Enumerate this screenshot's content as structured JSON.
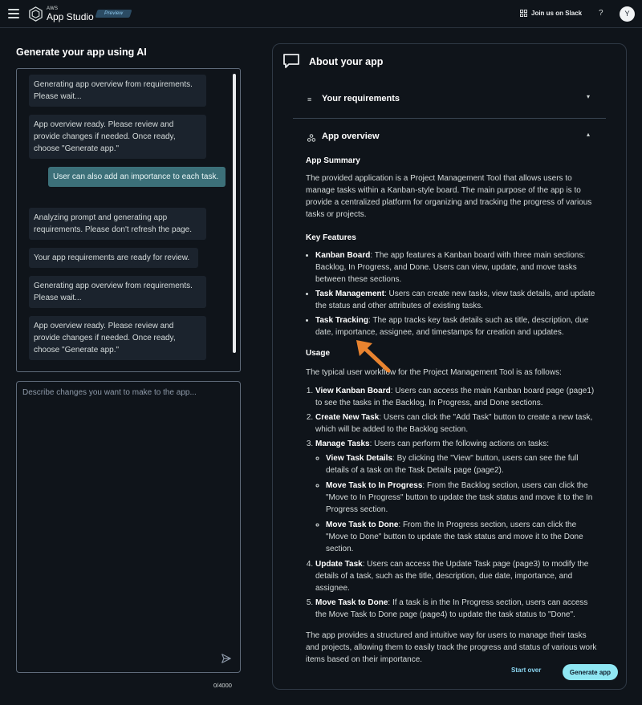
{
  "header": {
    "brand_prefix": "AWS",
    "brand_name": "App Studio",
    "badge": "Preview",
    "slack_link": "Join us on Slack",
    "help": "?",
    "avatar_initial": "Y"
  },
  "left": {
    "title": "Generate your app using AI",
    "messages": [
      {
        "from": "system",
        "text": "Generating app overview from requirements. Please wait..."
      },
      {
        "from": "system",
        "text": "App overview ready. Please review and provide changes if needed. Once ready, choose \"Generate app.\""
      },
      {
        "from": "user",
        "text": "User can also add an importance to each task."
      },
      {
        "from": "system",
        "text": "Analyzing prompt and generating app requirements. Please don't refresh the page."
      },
      {
        "from": "system",
        "text": "Your app requirements are ready for review."
      },
      {
        "from": "system",
        "text": "Generating app overview from requirements. Please wait..."
      },
      {
        "from": "system",
        "text": "App overview ready. Please review and provide changes if needed. Once ready, choose \"Generate app.\""
      }
    ],
    "composer_placeholder": "Describe changes you want to make to the app...",
    "char_count": "0/4000"
  },
  "right": {
    "title": "About your app",
    "sections": {
      "requirements": {
        "label": "Your requirements",
        "icon": "list-icon",
        "expanded": false
      },
      "overview": {
        "label": "App overview",
        "icon": "cluster-icon",
        "expanded": true
      }
    },
    "overview": {
      "summary_heading": "App Summary",
      "summary": "The provided application is a Project Management Tool that allows users to manage tasks within a Kanban-style board. The main purpose of the app is to provide a centralized platform for organizing and tracking the progress of various tasks or projects.",
      "features_heading": "Key Features",
      "features": [
        {
          "title": "Kanban Board",
          "text": ": The app features a Kanban board with three main sections: Backlog, In Progress, and Done. Users can view, update, and move tasks between these sections."
        },
        {
          "title": "Task Management",
          "text": ": Users can create new tasks, view task details, and update the status and other attributes of existing tasks."
        },
        {
          "title": "Task Tracking",
          "text": ": The app tracks key task details such as title, description, due date, importance, assignee, and timestamps for creation and updates."
        }
      ],
      "usage_heading": "Usage",
      "usage_intro": "The typical user workflow for the Project Management Tool is as follows:",
      "steps": [
        {
          "title": "View Kanban Board",
          "text": ": Users can access the main Kanban board page (page1) to see the tasks in the Backlog, In Progress, and Done sections."
        },
        {
          "title": "Create New Task",
          "text": ": Users can click the \"Add Task\" button to create a new task, which will be added to the Backlog section."
        },
        {
          "title": "Manage Tasks",
          "text": ": Users can perform the following actions on tasks:"
        },
        {
          "title": "Update Task",
          "text": ": Users can access the Update Task page (page3) to modify the details of a task, such as the title, description, due date, importance, and assignee."
        },
        {
          "title": "Move Task to Done",
          "text": ": If a task is in the In Progress section, users can access the Move Task to Done page (page4) to update the task status to \"Done\"."
        }
      ],
      "substeps": [
        {
          "title": "View Task Details",
          "text": ": By clicking the \"View\" button, users can see the full details of a task on the Task Details page (page2)."
        },
        {
          "title": "Move Task to In Progress",
          "text": ": From the Backlog section, users can click the \"Move to In Progress\" button to update the task status and move it to the In Progress section."
        },
        {
          "title": "Move Task to Done",
          "text": ": From the In Progress section, users can click the \"Move to Done\" button to update the task status and move it to the Done section."
        }
      ],
      "closing": "The app provides a structured and intuitive way for users to manage their tasks and projects, allowing them to easily track the progress and status of various work items based on their importance."
    },
    "buttons": {
      "start_over": "Start over",
      "generate": "Generate app"
    }
  },
  "colors": {
    "accent": "#8fe7f3",
    "user_bubble": "#3c7079",
    "annotation_arrow": "#e8832f"
  }
}
